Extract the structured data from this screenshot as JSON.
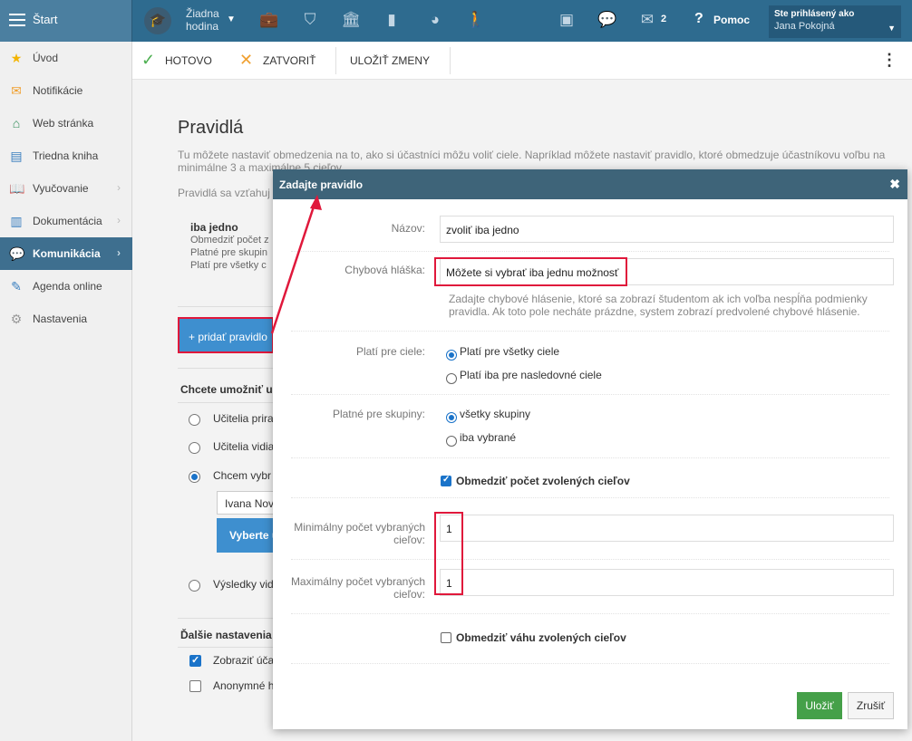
{
  "topbar": {
    "start_label": "Štart",
    "no_lesson_line1": "Žiadna",
    "no_lesson_line2": "hodina",
    "messages_count": "2",
    "help_label": "Pomoc",
    "user_line1": "Ste prihlásený ako",
    "user_line2": "Jana Pokojná"
  },
  "sidebar": {
    "items": [
      {
        "label": "Úvod"
      },
      {
        "label": "Notifikácie"
      },
      {
        "label": "Web stránka"
      },
      {
        "label": "Triedna kniha"
      },
      {
        "label": "Vyučovanie"
      },
      {
        "label": "Dokumentácia"
      },
      {
        "label": "Komunikácia"
      },
      {
        "label": "Agenda online"
      },
      {
        "label": "Nastavenia"
      }
    ]
  },
  "toolbar": {
    "done_label": "HOTOVO",
    "close_label": "ZATVORIŤ",
    "save_label": "ULOŽIŤ ZMENY"
  },
  "page": {
    "title": "Pravidlá",
    "description": "Tu môžete nastaviť obmedzenia na to, ako si účastníci môžu voliť ciele. Napríklad môžete nastaviť pravidlo, ktoré obmedzuje účastníkovu voľbu na minimálne 3 a maximálne 5 cieľov.",
    "applies_text": "Pravidlá sa vzťahuj",
    "rule_name": "iba jedno",
    "rule_line1": "Obmedziť počet z",
    "rule_line2": "Platné pre skupin",
    "rule_line3": "Platí pre všetky c",
    "add_rule_label": "+ pridať pravidlo",
    "section1_title": "Chcete umožniť u",
    "option1": "Učitelia prira",
    "option2": "Učitelia vidia",
    "option3": "Chcem vybr",
    "select_value": "Ivana Nov",
    "choose_btn": "Vyberte u",
    "option4": "Výsledky vid",
    "section2_title": "Ďalšie nastavenia",
    "check1": "Zobraziť úča",
    "check2": "Anonymné h"
  },
  "modal": {
    "title": "Zadajte pravidlo",
    "name_label": "Názov:",
    "name_value": "zvoliť iba jedno",
    "error_label": "Chybová hláška:",
    "error_value": "Môžete si vybrať iba jednu možnosť",
    "error_help": "Zadajte chybové hlásenie, ktoré sa zobrazí študentom ak ich voľba nespĺňa podmienky pravidla. Ak toto pole necháte prázdne, system zobrazí predvolené chybové hlásenie.",
    "targets_label": "Platí pre ciele:",
    "targets_all": "Platí pre všetky ciele",
    "targets_some": "Platí iba pre nasledovné ciele",
    "groups_label": "Platné pre skupiny:",
    "groups_all": "všetky skupiny",
    "groups_some": "iba vybrané",
    "limit_count_label": "Obmedziť počet zvolených cieľov",
    "min_label_1": "Minimálny počet vybraných",
    "min_label_2": "cieľov:",
    "min_value": "1",
    "max_label_1": "Maximálny počet vybraných",
    "max_label_2": "cieľov:",
    "max_value": "1",
    "limit_weight_label": "Obmedziť váhu zvolených cieľov",
    "save_label": "Uložiť",
    "cancel_label": "Zrušiť"
  },
  "colors": {
    "topbar": "#2e6b8f",
    "sidebar_active": "#3e6f8f",
    "modal_header": "#3e6479",
    "primary_button": "#3e8fcf",
    "save_button": "#45a049",
    "highlight": "#e0183b"
  }
}
